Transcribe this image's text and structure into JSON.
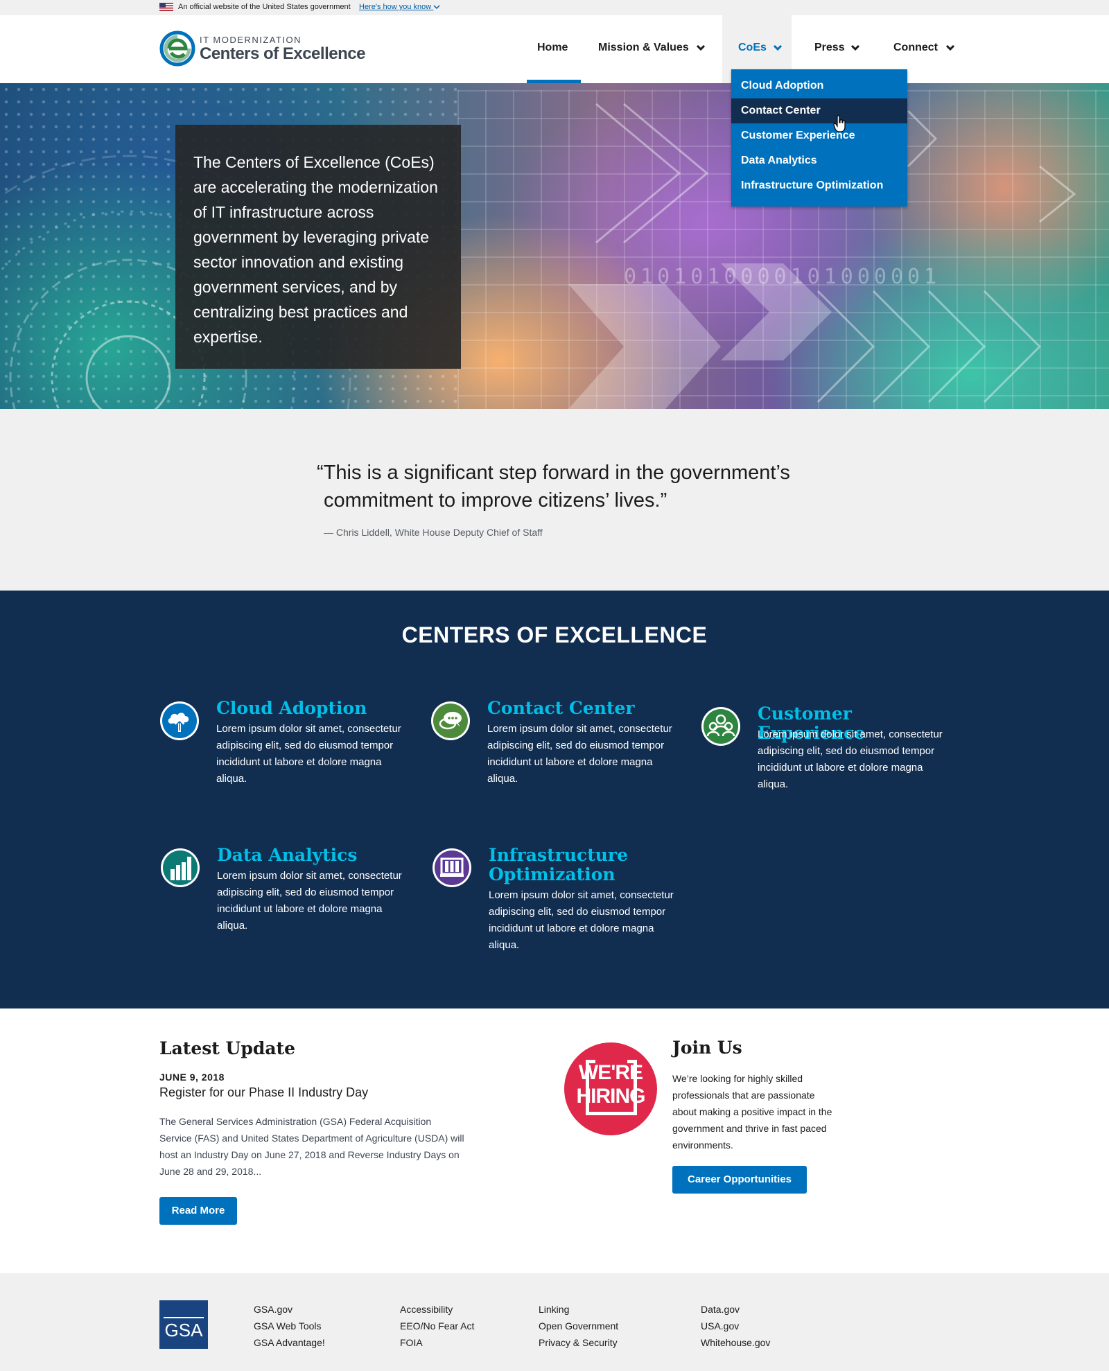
{
  "gov_banner": {
    "text": "An official website of the United States government",
    "link": "Here's how you know"
  },
  "header": {
    "logo_kicker": "IT MODERNIZATION",
    "logo_name": "Centers of Excellence",
    "nav": {
      "home": "Home",
      "mission": "Mission & Values",
      "coes": "CoEs",
      "press": "Press",
      "connect": "Connect"
    },
    "active_nav": "Home",
    "open_menu": "CoEs",
    "accent_color": "#0071bc"
  },
  "coes_menu": {
    "items": [
      "Cloud Adoption",
      "Contact Center",
      "Customer Experience",
      "Data Analytics",
      "Infrastructure Optimization"
    ],
    "hovered": "Contact Center"
  },
  "hero": {
    "text": "The Centers of Excellence (CoEs) are accelerating the modernization of IT infrastructure across government by leveraging private sector innovation and existing government services, and by centralizing best practices and expertise.",
    "binary": "0101010000101000001"
  },
  "quote": {
    "text": "“This is a significant step forward in the government’s commitment to improve citizens’ lives.”",
    "attribution": "— Chris Liddell, White House Deputy Chief of Staff"
  },
  "coe_section": {
    "heading": "CENTERS OF EXCELLENCE",
    "background": "#112e51",
    "title_color": "#02bfe7",
    "cards": [
      {
        "title": "Cloud Adoption",
        "desc": "Lorem ipsum dolor sit amet, consectetur adipiscing elit, sed do eiusmod tempor incididunt ut labore et dolore magna aliqua.",
        "icon": "cloud-upload-icon",
        "icon_color": "#0071bc"
      },
      {
        "title": "Contact Center",
        "desc": "Lorem ipsum dolor sit amet, consectetur adipiscing elit, sed do eiusmod tempor incididunt ut labore et dolore magna aliqua.",
        "icon": "chat-bubbles-icon",
        "icon_color": "#4b8b3b"
      },
      {
        "title": "Customer Experience",
        "desc": "Lorem ipsum dolor sit amet, consectetur adipiscing elit, sed do eiusmod tempor incididunt ut labore et dolore magna aliqua.",
        "icon": "users-icon",
        "icon_color": "#2e8540"
      },
      {
        "title": "Data Analytics",
        "desc": "Lorem ipsum dolor sit amet, consectetur adipiscing elit, sed do eiusmod tempor incididunt ut labore et dolore magna aliqua.",
        "icon": "bar-chart-icon",
        "icon_color": "#0b7a75"
      },
      {
        "title": "Infrastructure Optimization",
        "desc": "Lorem ipsum dolor sit amet, consectetur adipiscing elit, sed do eiusmod tempor incididunt ut labore et dolore magna aliqua.",
        "icon": "server-icon",
        "icon_color": "#5b3a96"
      }
    ]
  },
  "latest_update": {
    "heading": "Latest Update",
    "date": "JUNE 9, 2018",
    "title": "Register for our Phase II Industry Day",
    "body": "The General Services Administration (GSA) Federal Acquisition Service (FAS) and United States Department of Agriculture (USDA) will host an Industry Day on June 27, 2018 and Reverse Industry Days on June 28 and 29, 2018...",
    "button": "Read More"
  },
  "join_us": {
    "badge": "WE'RE HIRING",
    "badge_color": "#e0284a",
    "heading": "Join Us",
    "body": "We’re looking for highly skilled professionals that are passionate about making a positive impact in the government and thrive in fast paced environments.",
    "button": "Career Opportunities"
  },
  "footer": {
    "logo": "GSA",
    "columns": [
      [
        "GSA.gov",
        "GSA Web Tools",
        "GSA Advantage!"
      ],
      [
        "Accessibility",
        "EEO/No Fear Act",
        "FOIA"
      ],
      [
        "Linking",
        "Open Government",
        "Privacy & Security"
      ],
      [
        "Data.gov",
        "USA.gov",
        "Whitehouse.gov"
      ]
    ]
  }
}
